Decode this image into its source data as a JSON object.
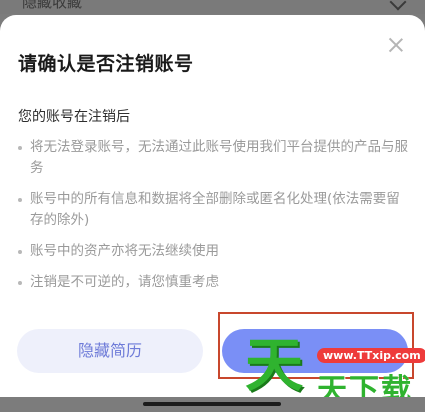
{
  "background": {
    "partial_text": "隐藏收藏"
  },
  "dialog": {
    "title": "请确认是否注销账号",
    "subtitle": "您的账号在注销后",
    "items": [
      "将无法登录账号，无法通过此账号使用我们平台提供的产品与服务",
      "账号中的所有信息和数据将全部删除或匿名化处理(依法需要留存的除外)",
      "账号中的资产亦将无法继续使用",
      "注销是不可逆的，请您慎重考虑"
    ],
    "secondary_button": "隐藏简历",
    "primary_button": ""
  },
  "watermark": {
    "logo": "天",
    "url": "www.TTxip.com",
    "name": "天下载"
  },
  "colors": {
    "primary": "#7a8ff6",
    "secondary_bg": "#eef0fb",
    "highlight": "#c8472d"
  }
}
